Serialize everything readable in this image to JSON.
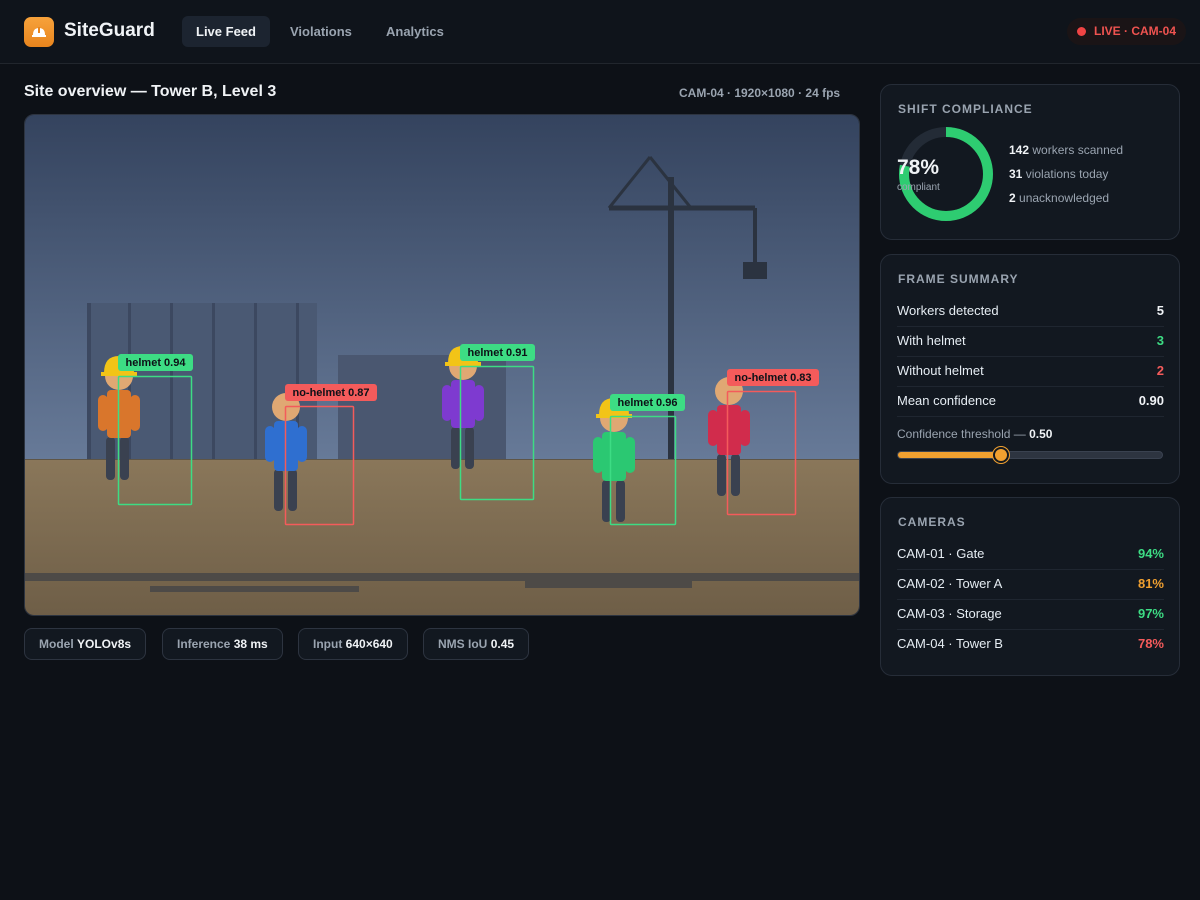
{
  "app": {
    "name": "SiteGuard",
    "tabs": [
      {
        "label": "Live Feed",
        "active": true
      },
      {
        "label": "Violations",
        "active": false
      },
      {
        "label": "Analytics",
        "active": false
      }
    ],
    "live_badge": "LIVE · CAM-04"
  },
  "main": {
    "title": "Site overview — Tower B, Level 3",
    "camera_meta": "CAM-04 · 1920×1080 · 24 fps",
    "detections": [
      {
        "label": "helmet 0.94",
        "class": "helmet"
      },
      {
        "label": "no-helmet 0.87",
        "class": "no-helmet"
      },
      {
        "label": "helmet 0.91",
        "class": "helmet"
      },
      {
        "label": "helmet 0.96",
        "class": "helmet"
      },
      {
        "label": "no-helmet 0.83",
        "class": "no-helmet"
      }
    ],
    "chips": [
      {
        "key": "Model",
        "value": "YOLOv8s"
      },
      {
        "key": "Inference",
        "value": "38 ms"
      },
      {
        "key": "Input",
        "value": "640×640"
      },
      {
        "key": "NMS IoU",
        "value": "0.45"
      }
    ]
  },
  "compliance": {
    "title": "SHIFT COMPLIANCE",
    "percent_label": "78%",
    "percent_value": 0.78,
    "sub": "compliant",
    "stats": [
      {
        "num": "142",
        "text": "workers scanned"
      },
      {
        "num": "31",
        "text": "violations today"
      },
      {
        "num": "2",
        "text": "unacknowledged"
      }
    ]
  },
  "frame_summary": {
    "title": "FRAME SUMMARY",
    "rows": [
      {
        "label": "Workers detected",
        "value": "5",
        "color": "#f0f3f6"
      },
      {
        "label": "With helmet",
        "value": "3",
        "color": "#3ddc84"
      },
      {
        "label": "Without helmet",
        "value": "2",
        "color": "#f45b5b"
      },
      {
        "label": "Mean confidence",
        "value": "0.90",
        "color": "#f0f3f6"
      }
    ],
    "threshold_label": "Confidence threshold —",
    "threshold_value": "0.50",
    "threshold_fraction": 0.39
  },
  "cameras": {
    "title": "CAMERAS",
    "items": [
      {
        "label": "CAM-01 · Gate",
        "value": "94%",
        "color": "#3ddc84"
      },
      {
        "label": "CAM-02 · Tower A",
        "value": "81%",
        "color": "#f0a030"
      },
      {
        "label": "CAM-03 · Storage",
        "value": "97%",
        "color": "#3ddc84"
      },
      {
        "label": "CAM-04 · Tower B",
        "value": "78%",
        "color": "#f45b5b"
      }
    ]
  },
  "colors": {
    "accent": "#f0a030",
    "ok": "#3ddc84",
    "bad": "#f45b5b"
  }
}
